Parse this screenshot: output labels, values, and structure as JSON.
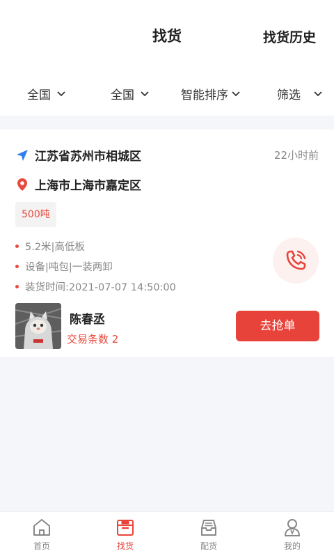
{
  "header": {
    "title": "找货",
    "history_label": "找货历史"
  },
  "filters": [
    {
      "label": "全国",
      "icon": "chevron-down-icon"
    },
    {
      "label": "全国",
      "icon": "chevron-down-icon"
    },
    {
      "label": "智能排序",
      "icon": "chevron-down-icon"
    },
    {
      "label": "筛选",
      "icon": "chevron-down-icon"
    }
  ],
  "card": {
    "origin": "江苏省苏州市相城区",
    "destination": "上海市上海市嘉定区",
    "time_ago": "22小时前",
    "weight": "500吨",
    "details": [
      "5.2米|高低板",
      "设备|吨包|一装两卸",
      "装货时间:2021-07-07 14:50:00"
    ],
    "shipper": {
      "name": "陈春丞",
      "trade_count": "交易条数 2"
    },
    "grab_label": "去抢单"
  },
  "tabbar": {
    "items": [
      {
        "label": "首页",
        "icon": "home-icon",
        "active": false
      },
      {
        "label": "找货",
        "icon": "box-icon",
        "active": true
      },
      {
        "label": "配货",
        "icon": "inbox-icon",
        "active": false
      },
      {
        "label": "我的",
        "icon": "user-icon",
        "active": false
      }
    ]
  },
  "colors": {
    "accent": "#e8433a",
    "location_blue": "#2f80ed",
    "text_gray": "#888888"
  }
}
